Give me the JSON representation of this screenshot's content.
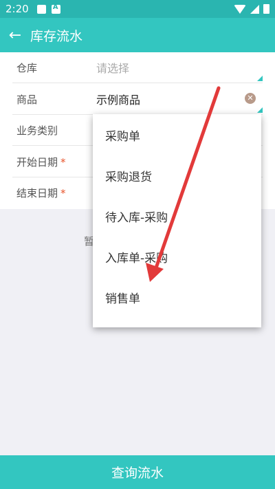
{
  "status_bar": {
    "time": "2:20"
  },
  "app_bar": {
    "title": "库存流水"
  },
  "form": {
    "rows": [
      {
        "label": "仓库",
        "required": "",
        "placeholder": "请选择",
        "value": ""
      },
      {
        "label": "商品",
        "required": "",
        "placeholder": "",
        "value": "示例商品"
      },
      {
        "label": "业务类别",
        "required": "",
        "placeholder": "",
        "value": ""
      },
      {
        "label": "开始日期",
        "required": "*",
        "placeholder": "",
        "value": ""
      },
      {
        "label": "结束日期",
        "required": "*",
        "placeholder": "",
        "value": ""
      }
    ]
  },
  "empty_text": "暂",
  "dropdown": {
    "options": [
      "采购单",
      "采购退货",
      "待入库-采购",
      "入库单-采购",
      "销售单"
    ]
  },
  "query_button": {
    "label": "查询流水"
  },
  "colors": {
    "accent": "#33c6c0",
    "status": "#2ab5b0",
    "required": "#e8542b",
    "arrow": "#e23a3a"
  }
}
